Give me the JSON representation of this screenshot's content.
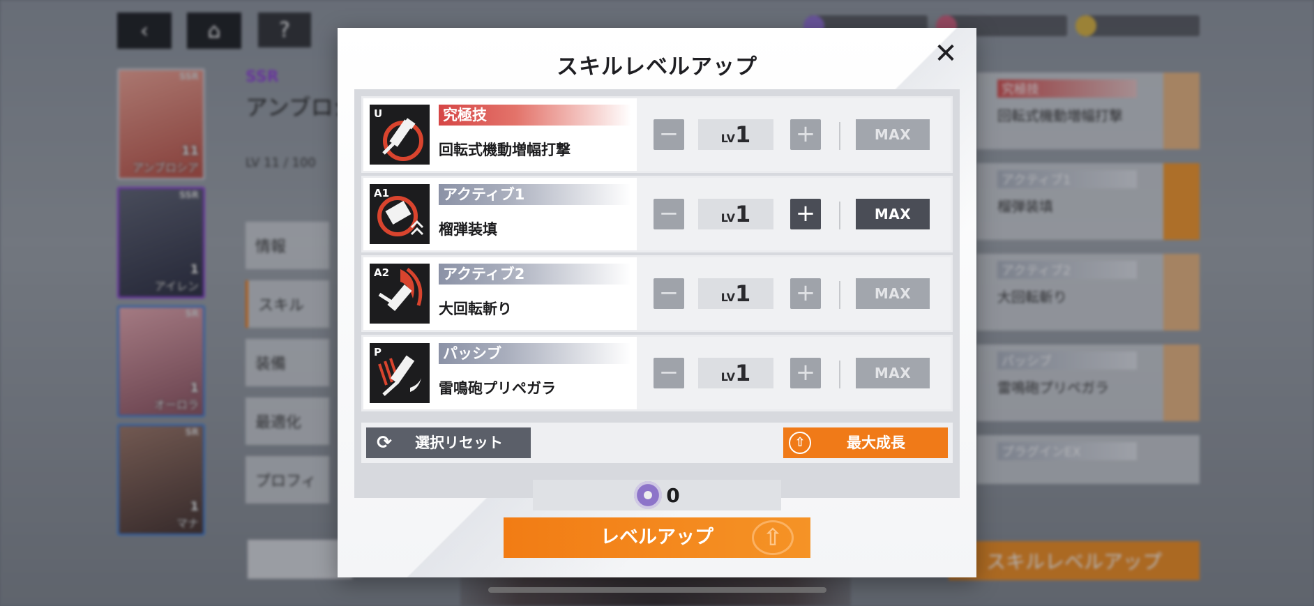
{
  "background": {
    "top_buttons": {
      "back": "‹",
      "home": "⌂",
      "help": "?"
    },
    "currencies": [
      "",
      "",
      ""
    ],
    "characters": [
      {
        "name": "アンブロシア",
        "rarity": "SSR",
        "level": "11",
        "color": "#e8705a"
      },
      {
        "name": "アイレン",
        "rarity": "SSR",
        "level": "1",
        "color": "#2d3040"
      },
      {
        "name": "オーロラ",
        "rarity": "SR",
        "level": "1",
        "color": "#d0848c"
      },
      {
        "name": "マナ",
        "rarity": "SR",
        "level": "1",
        "color": "#6a4a3e"
      }
    ],
    "selected": {
      "rarity": "SSR",
      "name": "アンブロシア",
      "level": "LV 11 / 100"
    },
    "side_menu": [
      "情報",
      "スキル",
      "装備",
      "最適化",
      "プロフィ"
    ],
    "right_rows": [
      {
        "tag": "究極技",
        "text": "回転式機動増幅打撃",
        "ult": true
      },
      {
        "tag": "アクティブ1",
        "text": "榴弾装填",
        "ult": false
      },
      {
        "tag": "アクティブ2",
        "text": "大回転斬り",
        "ult": false
      },
      {
        "tag": "パッシブ",
        "text": "雷鳴砲プリペガラ",
        "ult": false
      }
    ],
    "plugin_label": "プラグインEX",
    "bottom_button": "スキルレベルアップ"
  },
  "modal": {
    "title": "スキルレベルアップ",
    "close": "✕",
    "lv_prefix": "LV",
    "max_label": "MAX",
    "minus": "−",
    "plus": "+",
    "skills": [
      {
        "code": "U",
        "type": "究極技",
        "name": "回転式機動増幅打撃",
        "level": "1",
        "plus_active": false,
        "max_active": false,
        "ult": true
      },
      {
        "code": "A1",
        "type": "アクティブ1",
        "name": "榴弾装填",
        "level": "1",
        "plus_active": true,
        "max_active": true,
        "ult": false
      },
      {
        "code": "A2",
        "type": "アクティブ2",
        "name": "大回転斬り",
        "level": "1",
        "plus_active": false,
        "max_active": false,
        "ult": false
      },
      {
        "code": "P",
        "type": "パッシブ",
        "name": "雷鳴砲プリペガラ",
        "level": "1",
        "plus_active": false,
        "max_active": false,
        "ult": false
      }
    ],
    "reset_label": "選択リセット",
    "max_grow_label": "最大成長",
    "cost_value": "0",
    "levelup_label": "レベルアップ"
  },
  "colors": {
    "accent_orange": "#f07a18",
    "ultimate_red": "#d64646",
    "dark_button": "#4a4d56"
  }
}
